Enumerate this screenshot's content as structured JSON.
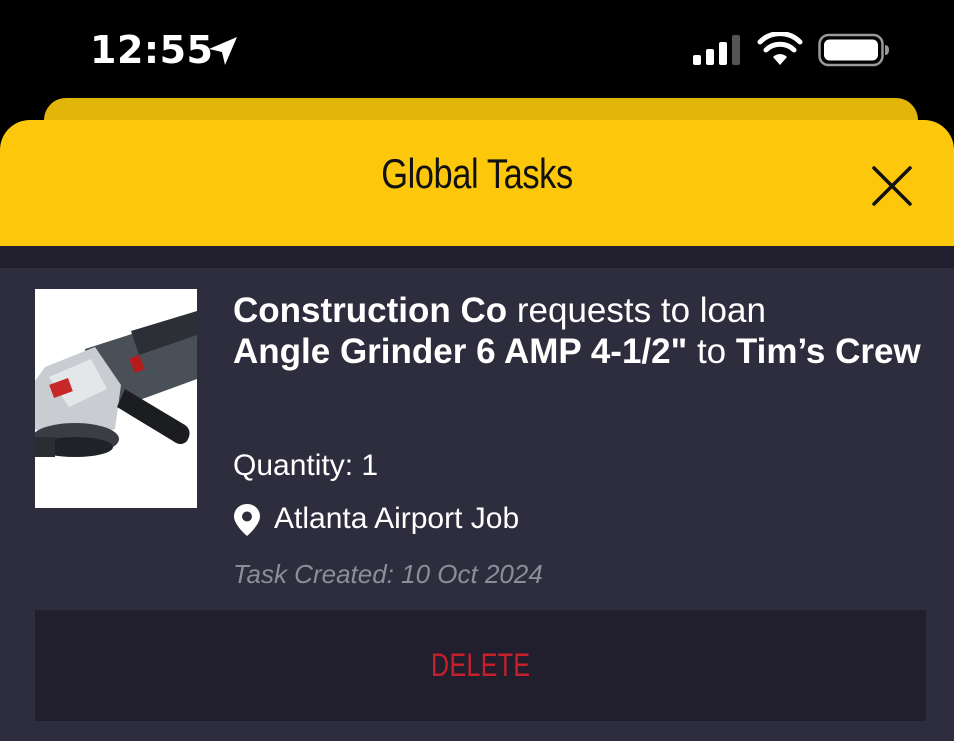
{
  "status_bar": {
    "time": "12:55"
  },
  "header": {
    "title": "Global Tasks"
  },
  "task": {
    "requester": "Construction Co",
    "verb": "requests to loan",
    "item": "Angle Grinder 6 AMP 4-1/2\"",
    "connector": "to",
    "recipient": "Tim’s Crew",
    "quantity": "Quantity: 1",
    "location": "Atlanta Airport Job",
    "created": "Task Created: 10 Oct 2024",
    "delete_label": "DELETE"
  },
  "colors": {
    "header_yellow": "#fdc80b",
    "content_bg": "#2e2d3d",
    "delete_red": "#c8202a"
  }
}
